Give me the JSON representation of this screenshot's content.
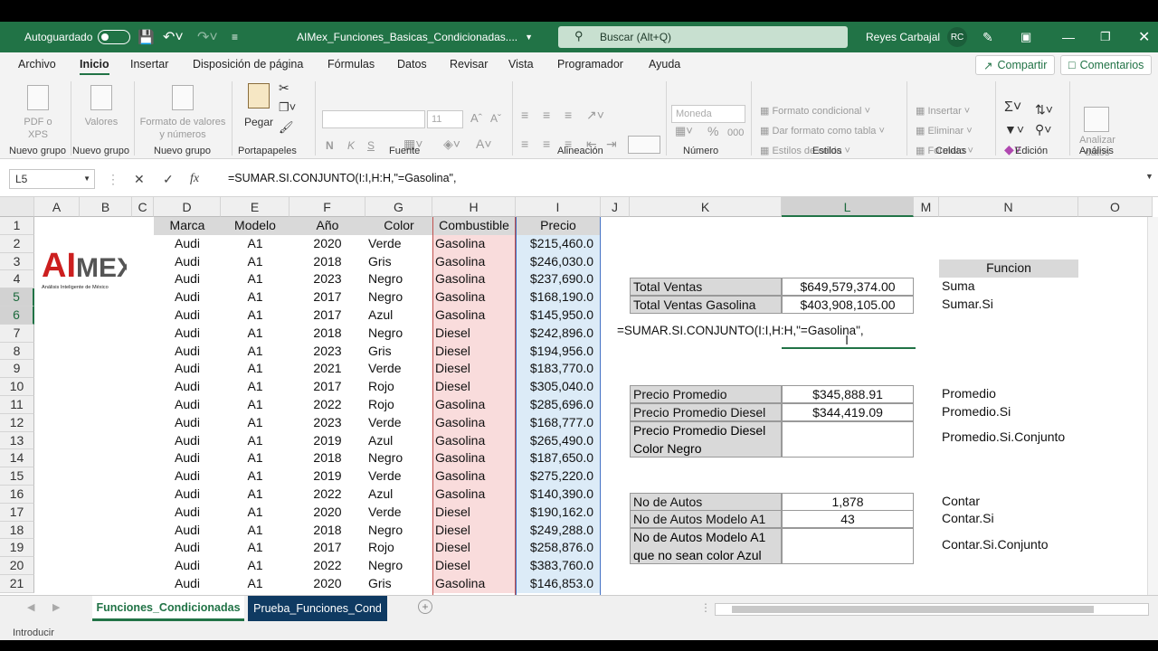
{
  "titlebar": {
    "autosave_label": "Autoguardado",
    "file_name": "AIMex_Funciones_Basicas_Condicionadas....",
    "search_placeholder": "Buscar (Alt+Q)",
    "user_name": "Reyes Carbajal",
    "user_initials": "RC"
  },
  "menu": {
    "items": [
      "Archivo",
      "Inicio",
      "Insertar",
      "Disposición de página",
      "Fórmulas",
      "Datos",
      "Revisar",
      "Vista",
      "Programador",
      "Ayuda"
    ],
    "active": "Inicio",
    "share_label": "Compartir",
    "comments_label": "Comentarios"
  },
  "ribbon": {
    "pdf_label": "PDF o XPS",
    "values_label": "Valores",
    "format_values_label": "Formato de valores y números",
    "paste_label": "Pegar",
    "font_size": "11",
    "number_format": "Moneda",
    "conditional_format": "Formato condicional",
    "format_as_table": "Dar formato como tabla",
    "cell_styles": "Estilos de celda",
    "insert_label": "Insertar",
    "delete_label": "Eliminar",
    "format_label": "Formato",
    "analyze_label": "Analizar datos",
    "bold": "N",
    "italic": "K",
    "underline": "S",
    "percent": "%",
    "thousands": "000",
    "groups": [
      "Nuevo grupo",
      "Nuevo grupo",
      "Nuevo grupo",
      "Portapapeles",
      "Fuente",
      "Alineación",
      "Número",
      "Estilos",
      "Celdas",
      "Edición",
      "Análisis"
    ]
  },
  "formula_bar": {
    "name_box": "L5",
    "formula": "=SUMAR.SI.CONJUNTO(I:I,H:H,\"=Gasolina\","
  },
  "columns": [
    "A",
    "B",
    "C",
    "D",
    "E",
    "F",
    "G",
    "H",
    "I",
    "J",
    "K",
    "L",
    "M",
    "N",
    "O"
  ],
  "rows": [
    "1",
    "2",
    "3",
    "4",
    "5",
    "6",
    "7",
    "8",
    "9",
    "10",
    "11",
    "12",
    "13",
    "14",
    "15",
    "16",
    "17",
    "18",
    "19",
    "20",
    "21"
  ],
  "table": {
    "headers": [
      "Marca",
      "Modelo",
      "Año",
      "Color",
      "Combustible",
      "Precio"
    ],
    "rows": [
      [
        "Audi",
        "A1",
        "2020",
        "Verde",
        "Gasolina",
        "$215,460.0"
      ],
      [
        "Audi",
        "A1",
        "2018",
        "Gris",
        "Gasolina",
        "$246,030.0"
      ],
      [
        "Audi",
        "A1",
        "2023",
        "Negro",
        "Gasolina",
        "$237,690.0"
      ],
      [
        "Audi",
        "A1",
        "2017",
        "Negro",
        "Gasolina",
        "$168,190.0"
      ],
      [
        "Audi",
        "A1",
        "2017",
        "Azul",
        "Gasolina",
        "$145,950.0"
      ],
      [
        "Audi",
        "A1",
        "2018",
        "Negro",
        "Diesel",
        "$242,896.0"
      ],
      [
        "Audi",
        "A1",
        "2023",
        "Gris",
        "Diesel",
        "$194,956.0"
      ],
      [
        "Audi",
        "A1",
        "2021",
        "Verde",
        "Diesel",
        "$183,770.0"
      ],
      [
        "Audi",
        "A1",
        "2017",
        "Rojo",
        "Diesel",
        "$305,040.0"
      ],
      [
        "Audi",
        "A1",
        "2022",
        "Rojo",
        "Gasolina",
        "$285,696.0"
      ],
      [
        "Audi",
        "A1",
        "2023",
        "Verde",
        "Gasolina",
        "$168,777.0"
      ],
      [
        "Audi",
        "A1",
        "2019",
        "Azul",
        "Gasolina",
        "$265,490.0"
      ],
      [
        "Audi",
        "A1",
        "2018",
        "Negro",
        "Gasolina",
        "$187,650.0"
      ],
      [
        "Audi",
        "A1",
        "2019",
        "Verde",
        "Gasolina",
        "$275,220.0"
      ],
      [
        "Audi",
        "A1",
        "2022",
        "Azul",
        "Gasolina",
        "$140,390.0"
      ],
      [
        "Audi",
        "A1",
        "2020",
        "Verde",
        "Diesel",
        "$190,162.0"
      ],
      [
        "Audi",
        "A1",
        "2018",
        "Negro",
        "Diesel",
        "$249,288.0"
      ],
      [
        "Audi",
        "A1",
        "2017",
        "Rojo",
        "Diesel",
        "$258,876.0"
      ],
      [
        "Audi",
        "A1",
        "2022",
        "Negro",
        "Diesel",
        "$383,760.0"
      ],
      [
        "Audi",
        "A1",
        "2020",
        "Gris",
        "Gasolina",
        "$146,853.0"
      ]
    ]
  },
  "summary": {
    "total_ventas_label": "Total Ventas",
    "total_ventas_value": "$649,579,374.00",
    "total_gasolina_label": "Total Ventas Gasolina",
    "total_gasolina_value": "$403,908,105.00",
    "editing_formula": "=SUMAR.SI.CONJUNTO(I:I,H:H,\"=Gasolina\",",
    "precio_promedio_label": "Precio Promedio",
    "precio_promedio_value": "$345,888.91",
    "precio_diesel_label": "Precio Promedio Diesel",
    "precio_diesel_value": "$344,419.09",
    "precio_diesel_negro_label_1": "Precio Promedio Diesel",
    "precio_diesel_negro_label_2": "Color Negro",
    "autos_label": "No de Autos",
    "autos_value": "1,878",
    "autos_a1_label": "No de Autos Modelo A1",
    "autos_a1_value": "43",
    "autos_azul_label_1": "No de Autos Modelo A1",
    "autos_azul_label_2": "que no sean color Azul"
  },
  "functions": {
    "header": "Funcion",
    "suma": "Suma",
    "sumar_si": "Sumar.Si",
    "promedio": "Promedio",
    "promedio_si": "Promedio.Si",
    "promedio_si_conjunto": "Promedio.Si.Conjunto",
    "contar": "Contar",
    "contar_si": "Contar.Si",
    "contar_si_conjunto": "Contar.Si.Conjunto"
  },
  "logo_text": "AIMEX",
  "logo_subtitle": "Análisis Inteligente de México",
  "sheets": [
    "Funciones_Condicionadas",
    "Prueba_Funciones_Cond"
  ],
  "status_text": "Introducir",
  "colors": {
    "excel_green": "#217346",
    "gas_pink": "#f9dcdc",
    "price_blue": "#dcebf7",
    "header_gray": "#d9d9d9"
  }
}
